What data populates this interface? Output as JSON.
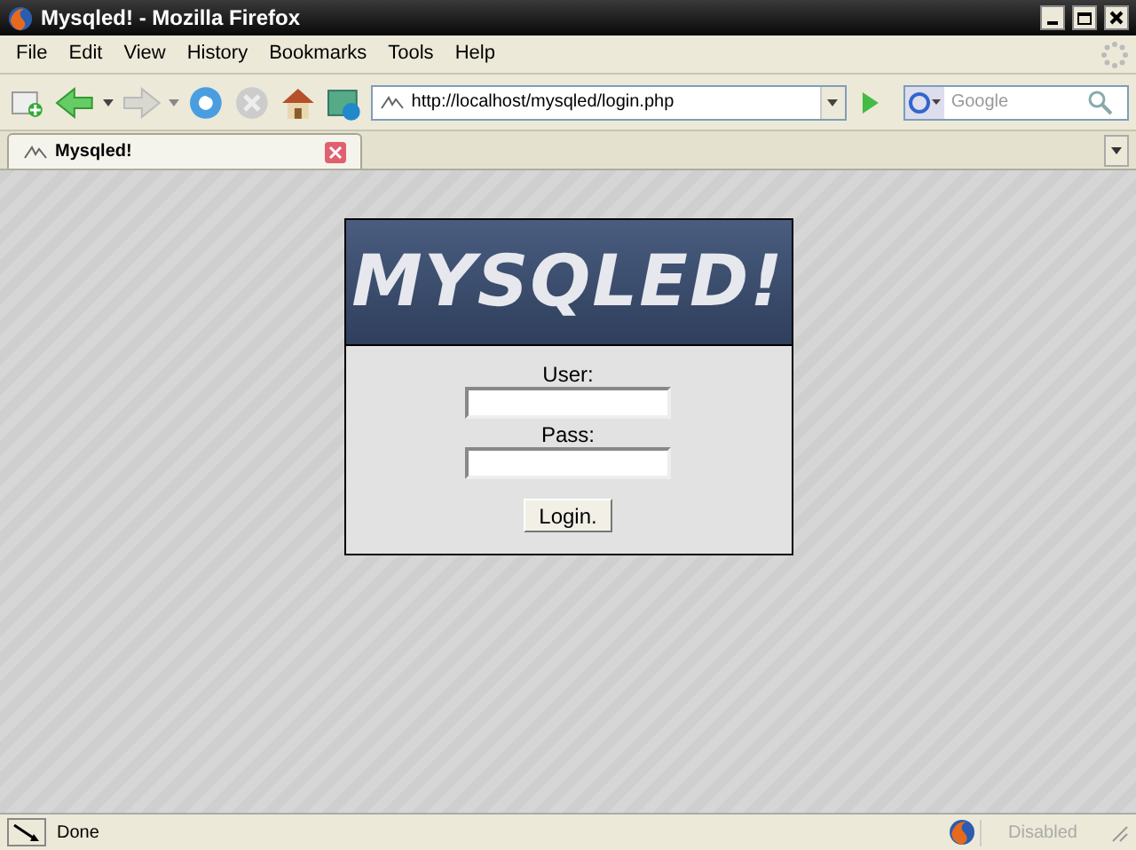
{
  "window": {
    "title": "Mysqled! - Mozilla Firefox"
  },
  "menu": [
    "File",
    "Edit",
    "View",
    "History",
    "Bookmarks",
    "Tools",
    "Help"
  ],
  "address": {
    "value": "http://localhost/mysqled/login.php"
  },
  "search": {
    "placeholder": "Google"
  },
  "tabs": [
    {
      "label": "Mysqled!",
      "selected": true
    }
  ],
  "page": {
    "logo": "MYSQLED!",
    "user_label": "User:",
    "pass_label": "Pass:",
    "button": "Login."
  },
  "status_bar": {
    "text": "Done",
    "addon": "Disabled"
  }
}
